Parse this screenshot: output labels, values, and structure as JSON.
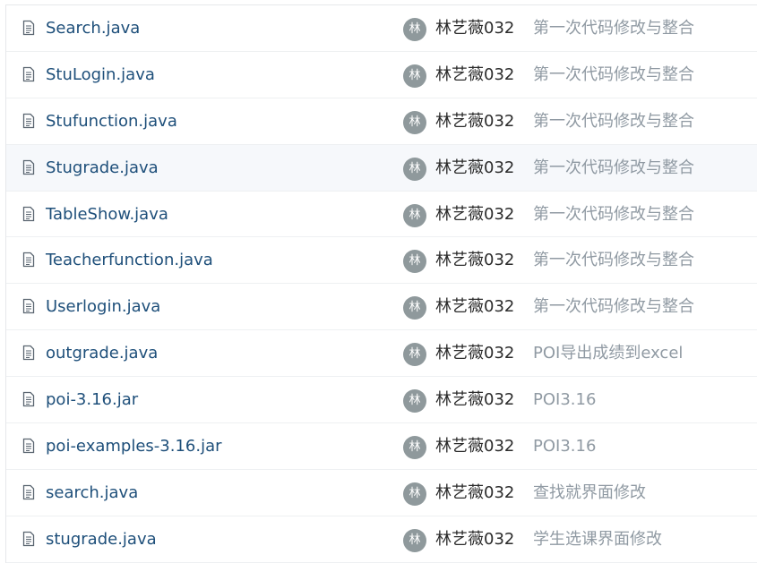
{
  "files": [
    {
      "name": "Search.java",
      "avatar": "林",
      "author": "林艺薇032",
      "commit": "第一次代码修改与整合"
    },
    {
      "name": "StuLogin.java",
      "avatar": "林",
      "author": "林艺薇032",
      "commit": "第一次代码修改与整合"
    },
    {
      "name": "Stufunction.java",
      "avatar": "林",
      "author": "林艺薇032",
      "commit": "第一次代码修改与整合"
    },
    {
      "name": "Stugrade.java",
      "avatar": "林",
      "author": "林艺薇032",
      "commit": "第一次代码修改与整合"
    },
    {
      "name": "TableShow.java",
      "avatar": "林",
      "author": "林艺薇032",
      "commit": "第一次代码修改与整合"
    },
    {
      "name": "Teacherfunction.java",
      "avatar": "林",
      "author": "林艺薇032",
      "commit": "第一次代码修改与整合"
    },
    {
      "name": "Userlogin.java",
      "avatar": "林",
      "author": "林艺薇032",
      "commit": "第一次代码修改与整合"
    },
    {
      "name": "outgrade.java",
      "avatar": "林",
      "author": "林艺薇032",
      "commit": "POI导出成绩到excel"
    },
    {
      "name": "poi-3.16.jar",
      "avatar": "林",
      "author": "林艺薇032",
      "commit": "POI3.16"
    },
    {
      "name": "poi-examples-3.16.jar",
      "avatar": "林",
      "author": "林艺薇032",
      "commit": "POI3.16"
    },
    {
      "name": "search.java",
      "avatar": "林",
      "author": "林艺薇032",
      "commit": "查找就界面修改"
    },
    {
      "name": "stugrade.java",
      "avatar": "林",
      "author": "林艺薇032",
      "commit": "学生选课界面修改"
    }
  ],
  "icon": "file-text-icon",
  "colors": {
    "file_link": "#1e4f7a",
    "commit_text": "#909aa3",
    "avatar_bg": "#8f999c",
    "hover_row": "#f6f8fb"
  }
}
